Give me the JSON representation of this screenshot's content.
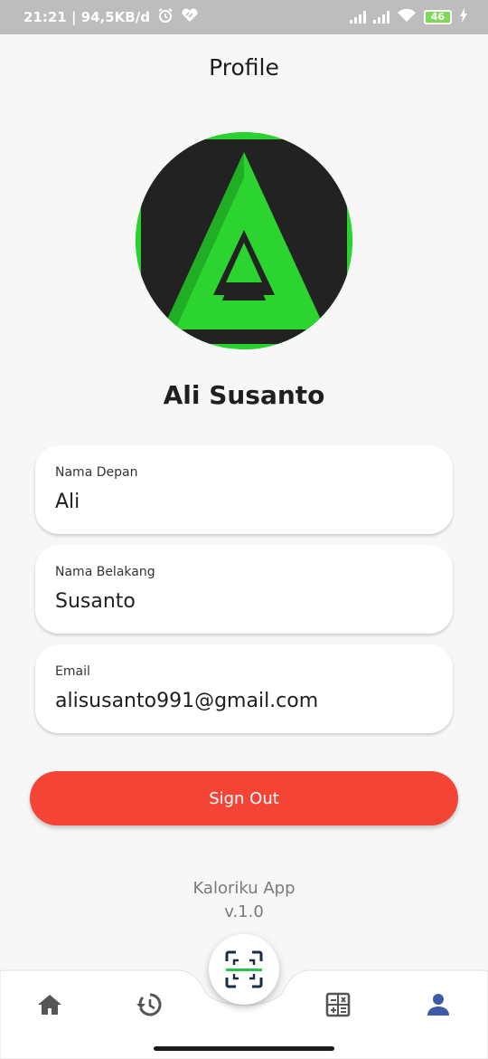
{
  "status_bar": {
    "time_speed": "21:21 | 94,5KB/d",
    "battery": "46"
  },
  "header": {
    "title": "Profile"
  },
  "profile": {
    "name": "Ali Susanto",
    "fields": [
      {
        "label": "Nama Depan",
        "value": "Ali"
      },
      {
        "label": "Nama Belakang",
        "value": "Susanto"
      },
      {
        "label": "Email",
        "value": "alisusanto991@gmail.com"
      }
    ]
  },
  "actions": {
    "sign_out": "Sign Out"
  },
  "footer": {
    "app_name": "Kaloriku App",
    "version": "v.1.0"
  },
  "bottom_nav": {
    "items": [
      "home-icon",
      "history-icon",
      "scan-icon",
      "calculator-icon",
      "person-icon"
    ],
    "active": "person-icon"
  },
  "colors": {
    "accent": "#3c5aa6",
    "sign_out": "#f44436",
    "logo_green": "#29d22e",
    "icon_gray": "#555555"
  }
}
